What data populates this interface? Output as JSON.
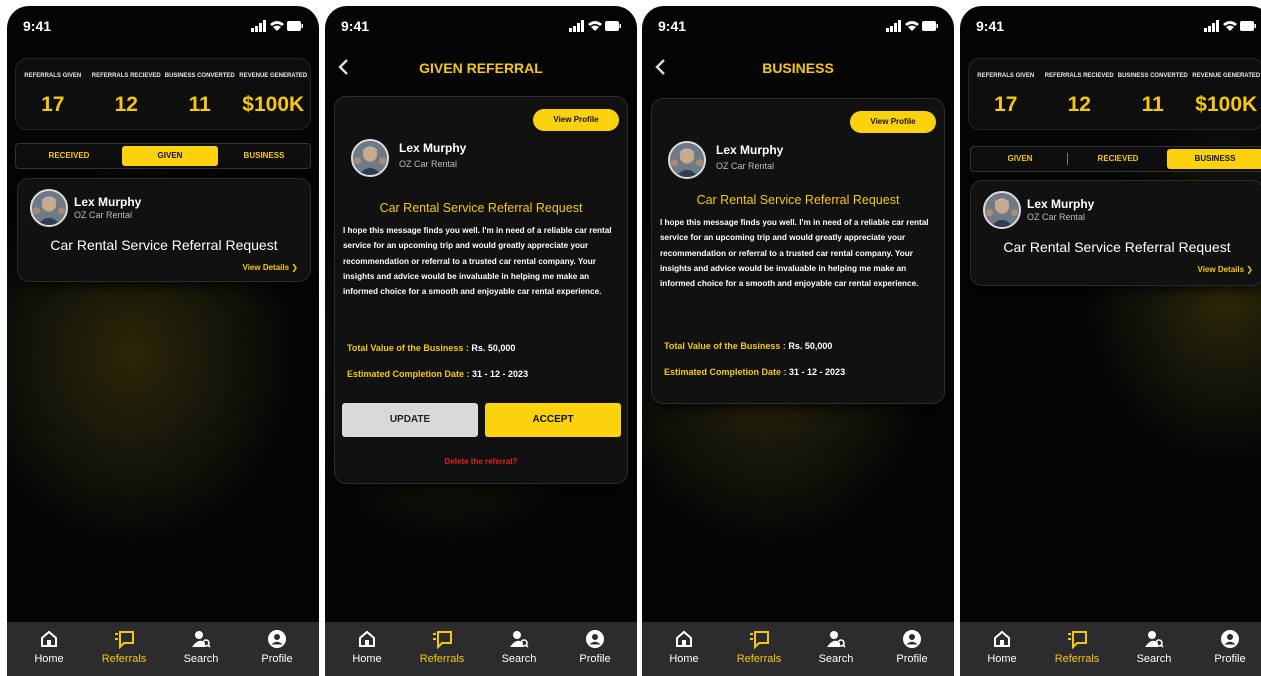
{
  "status": {
    "time": "9:41"
  },
  "stats": [
    {
      "label": "REFERRALS GIVEN",
      "value": "17"
    },
    {
      "label": "REFERRALS RECIEVED",
      "value": "12"
    },
    {
      "label": "BUSINESS CONVERTED",
      "value": "11"
    },
    {
      "label": "REVENUE GENERATED",
      "value": "$100K"
    }
  ],
  "screen1": {
    "tabs": [
      "RECEIVED",
      "GIVEN",
      "BUSINESS"
    ],
    "active_tab": "GIVEN"
  },
  "screen4": {
    "tabs": [
      "GIVEN",
      "RECIEVED",
      "BUSINESS"
    ],
    "active_tab": "BUSINESS"
  },
  "referral": {
    "name": "Lex Murphy",
    "company": "OZ Car Rental",
    "title": "Car Rental Service Referral Request",
    "view_details": "View Details"
  },
  "given_screen": {
    "title": "GIVEN REFERRAL"
  },
  "business_screen": {
    "title": "BUSINESS"
  },
  "detail": {
    "view_profile": "View Profile",
    "body": "I hope this message finds you well. I'm in need of a reliable car rental service for an upcoming trip and would greatly appreciate your recommendation or referral to a trusted car rental company. Your insights and advice would be invaluable in helping me make an informed choice for a smooth and enjoyable car rental experience.",
    "value_label": "Total Value of the Business :",
    "value": "Rs. 50,000",
    "date_label": "Estimated Completion Date :",
    "date": "31 - 12 - 2023",
    "update": "UPDATE",
    "accept": "ACCEPT",
    "delete": "Delete the referral?"
  },
  "nav": [
    {
      "label": "Home",
      "icon": "home-icon"
    },
    {
      "label": "Referrals",
      "icon": "referrals-icon"
    },
    {
      "label": "Search",
      "icon": "search-user-icon"
    },
    {
      "label": "Profile",
      "icon": "profile-icon"
    }
  ],
  "colors": {
    "accent": "#fcd20e",
    "danger": "#e02020",
    "nav_bg": "#2c2c2e"
  }
}
